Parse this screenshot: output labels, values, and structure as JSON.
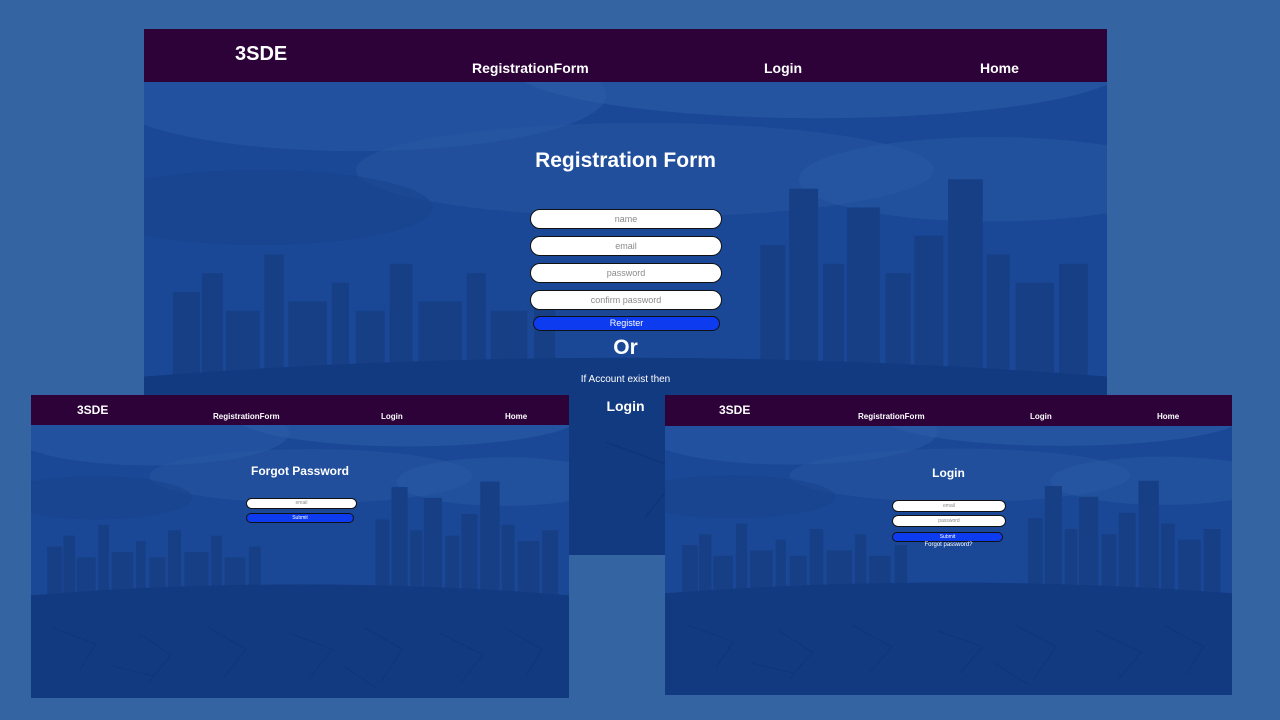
{
  "colors": {
    "page_background": "#3564a3",
    "navbar": "#2c0238",
    "panel_tint": "#1a4897",
    "button": "#0d3cf0"
  },
  "registration_page": {
    "navbar": {
      "brand": "3SDE",
      "links": [
        "RegistrationForm",
        "Login",
        "Home"
      ]
    },
    "title": "Registration Form",
    "inputs": [
      {
        "placeholder": "name"
      },
      {
        "placeholder": "email"
      },
      {
        "placeholder": "password"
      },
      {
        "placeholder": "confirm password"
      }
    ],
    "register_button": "Register",
    "or_text": "Or",
    "account_text": "If Account exist then",
    "login_link": "Login"
  },
  "forgot_password_page": {
    "navbar": {
      "brand": "3SDE",
      "links": [
        "RegistrationForm",
        "Login",
        "Home"
      ]
    },
    "title": "Forgot Password",
    "inputs": [
      {
        "placeholder": "email"
      }
    ],
    "submit_button": "Submit"
  },
  "login_page": {
    "navbar": {
      "brand": "3SDE",
      "links": [
        "RegistrationForm",
        "Login",
        "Home"
      ]
    },
    "title": "Login",
    "inputs": [
      {
        "placeholder": "email"
      },
      {
        "placeholder": "password"
      }
    ],
    "submit_button": "Submit",
    "forgot_link": "Forgot password?"
  }
}
